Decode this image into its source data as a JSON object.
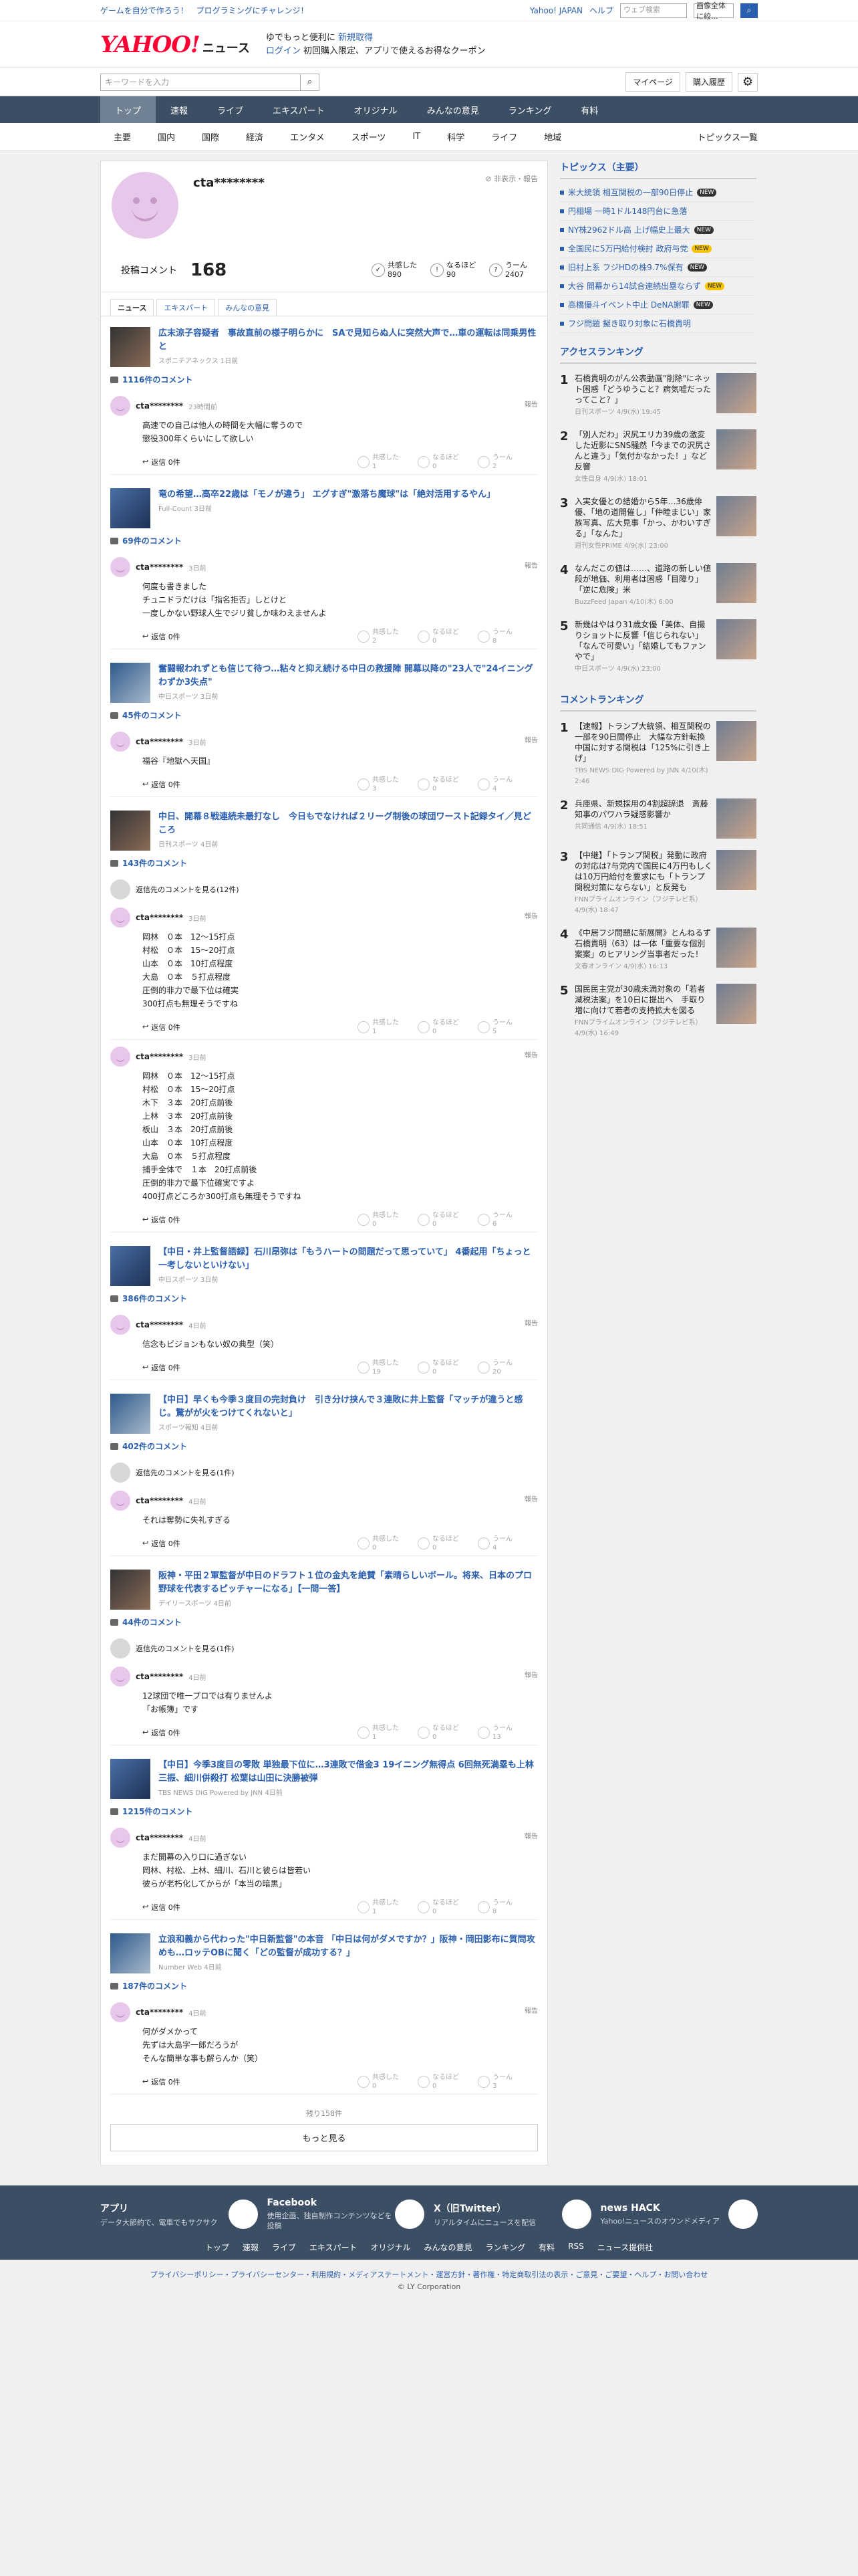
{
  "promo": {
    "left": [
      "ゲームを自分で作ろう！",
      "プログラミングにチャレンジ！"
    ],
    "right": [
      "Yahoo! JAPAN",
      "ヘルプ"
    ],
    "search_placeholder": "ウェブ検索",
    "search_scope": "画像全体に絞..."
  },
  "header": {
    "logo": "YAHOO!",
    "logo_sub": "JAPAN",
    "news": "ニュース",
    "promo1": "ゆでもっと便利に",
    "promo1_blue": "新規取得",
    "promo2_a": "ログイン",
    "promo2_b": "初回購入限定、アプリで使えるお得なクーポン"
  },
  "subheader": {
    "placeholder": "キーワードを入力",
    "mypage": "マイページ",
    "history": "購入履歴"
  },
  "mainnav": [
    "トップ",
    "速報",
    "ライブ",
    "エキスパート",
    "オリジナル",
    "みんなの意見",
    "ランキング",
    "有料"
  ],
  "catnav": [
    "主要",
    "国内",
    "国際",
    "経済",
    "エンタメ",
    "スポーツ",
    "IT",
    "科学",
    "ライフ",
    "地域"
  ],
  "catnav_topics": "トピックス一覧",
  "profile": {
    "name": "cta********",
    "report": "非表示・報告",
    "comment_label": "投稿コメント",
    "comment_count": "168",
    "r1_label": "共感した",
    "r1": "890",
    "r2_label": "なるほど",
    "r2": "90",
    "r3_label": "うーん",
    "r3": "2407"
  },
  "tabs": [
    "ニュース",
    "エキスパート",
    "みんなの意見"
  ],
  "reply_label": "返信 0件",
  "report_label": "報告",
  "vote_labels": [
    "共感した",
    "なるほど",
    "うーん"
  ],
  "articles": [
    {
      "title": "広末涼子容疑者　事故直前の様子明らかに　SAで見知らぬ人に突然大声で…車の運転は同乗男性と",
      "src": "スポニチアネックス 1日前",
      "count": "1116件のコメント",
      "comments": [
        {
          "name": "cta********",
          "time": "23時間前",
          "body": "高速での自己は他人の時間を大幅に奪うので\n懲役300年くらいにして欲しい",
          "votes": [
            "1",
            "0",
            "2"
          ]
        }
      ]
    },
    {
      "title": "竜の希望…高卒22歳は「モノが違う」 エグすぎ\"激落ち魔球\"は「絶対活用するやん」",
      "src": "Full-Count 3日前",
      "count": "69件のコメント",
      "comments": [
        {
          "name": "cta********",
          "time": "3日前",
          "body": "何度も書きました\nチュニドラだけは「指名拒否」しとけと\n一度しかない野球人生でジリ貧しか味わえませんよ",
          "votes": [
            "2",
            "0",
            "8"
          ]
        }
      ]
    },
    {
      "title": "奮闘報われずとも信じて待つ…粘々と抑え続ける中日の救援陣 開幕以降の\"23人で\"24イニングわずか3失点\"",
      "src": "中日スポーツ 3日前",
      "count": "45件のコメント",
      "comments": [
        {
          "name": "cta********",
          "time": "3日前",
          "body": "福谷『地獄へ天国』",
          "votes": [
            "3",
            "0",
            "4"
          ]
        }
      ]
    },
    {
      "title": "中日、開幕８戦連続未最打なし　今日もでなければ２リーグ制後の球団ワースト記録タイ／見どころ",
      "src": "日刊スポーツ 4日前",
      "count": "143件のコメント",
      "prev": "返信先のコメントを見る(12件)",
      "comments": [
        {
          "name": "cta********",
          "time": "3日前",
          "body": "岡林　０本　12〜15打点\n村松　０本　15〜20打点\n山本　０本　10打点程度\n大島　０本　５打点程度\n圧倒的非力で最下位は確実\n300打点も無理そうですね",
          "votes": [
            "1",
            "0",
            "5"
          ]
        },
        {
          "name": "cta********",
          "time": "3日前",
          "body": "岡林　０本　12〜15打点\n村松　０本　15〜20打点\n木下　３本　20打点前後\n上林　３本　20打点前後\n板山　３本　20打点前後\n山本　０本　10打点程度\n大島　０本　５打点程度\n捕手全体で　１本　20打点前後\n圧倒的非力で最下位確実ですよ\n400打点どころか300打点も無理そうですね",
          "votes": [
            "0",
            "0",
            "6"
          ]
        }
      ]
    },
    {
      "title": "【中日・井上監督語録】石川昂弥は「もうハートの問題だって思っていて」 4番起用「ちょっと一考しないといけない」",
      "src": "中日スポーツ 3日前",
      "count": "386件のコメント",
      "comments": [
        {
          "name": "cta********",
          "time": "4日前",
          "body": "信念もビジョンもない奴の典型（笑）",
          "votes": [
            "19",
            "0",
            "20"
          ]
        }
      ]
    },
    {
      "title": "【中日】早くも今季３度目の完封負け　引き分け挟んで３連敗に井上監督「マッチが違うと感じ。驚がが火をつけてくれないと」",
      "src": "スポーツ報知 4日前",
      "count": "402件のコメント",
      "prev": "返信先のコメントを見る(1件)",
      "comments": [
        {
          "name": "cta********",
          "time": "4日前",
          "body": "それは奪勢に失礼すぎる",
          "votes": [
            "0",
            "0",
            "4"
          ]
        }
      ]
    },
    {
      "title": "阪神・平田２軍監督が中日のドラフト１位の金丸を絶賛「素晴らしいボール。将来、日本のプロ野球を代表するピッチャーになる」【一問一答】",
      "src": "デイリースポーツ 4日前",
      "count": "44件のコメント",
      "prev": "返信先のコメントを見る(1件)",
      "comments": [
        {
          "name": "cta********",
          "time": "4日前",
          "body": "12球団で唯一プロでは有りませんよ\n「お帳簿」です",
          "votes": [
            "1",
            "0",
            "13"
          ]
        }
      ]
    },
    {
      "title": "【中日】今季3度目の零敗 単独最下位に…3連敗で借金3 19イニング無得点 6回無死満塁も上林三振、細川併殺打 松葉は山田に決勝被弾",
      "src": "TBS NEWS DIG Powered by JNN 4日前",
      "count": "1215件のコメント",
      "comments": [
        {
          "name": "cta********",
          "time": "4日前",
          "body": "まだ開幕の入り口に過ぎない\n岡林、村松、上林、細川、石川と彼らは皆若い\n彼らが老朽化してからが「本当の暗黒」",
          "votes": [
            "1",
            "0",
            "8"
          ]
        }
      ]
    },
    {
      "title": "立浪和義から代わった\"中日新監督\"の本音 「中日は何がダメですか？」阪神・岡田影布に質問攻めも…ロッテOBに聞く「どの監督が成功する？」",
      "src": "Number Web 4日前",
      "count": "187件のコメント",
      "comments": [
        {
          "name": "cta********",
          "time": "4日前",
          "body": "何がダメかって\n先ずは大島字一郎だろうが\nそんな簡単な事も解らんか（笑）",
          "votes": [
            "0",
            "0",
            "3"
          ]
        }
      ]
    }
  ],
  "more": {
    "count": "残り158件",
    "label": "もっと見る"
  },
  "side": {
    "topics_title": "トピックス（主要）",
    "topics": [
      {
        "t": "米大統領 相互関税の一部90日停止",
        "b": "NEW"
      },
      {
        "t": "円相場 一時1ドル148円台に急落",
        "b": ""
      },
      {
        "t": "NY株2962ドル高 上げ幅史上最大",
        "b": "NEW"
      },
      {
        "t": "全国民に5万円給付検討 政府与党",
        "b": "NEW"
      },
      {
        "t": "旧村上系 フジHDの株9.7%保有",
        "b": "NEW"
      },
      {
        "t": "大谷 開幕から14試合連続出塁ならず",
        "b": "NEW"
      },
      {
        "t": "高橋優斗イベント中止 DeNA謝罪",
        "b": "NEW"
      },
      {
        "t": "フジ問題 擬き取り対象に石橋貴明",
        "b": ""
      }
    ],
    "access_title": "アクセスランキング",
    "access": [
      {
        "n": "1",
        "t": "石橋貴明のがん公表動画\"削除\"にネット困惑「どうゆうこと？病気嘘だったってこと？」",
        "s": "日刊スポーツ 4/9(水) 19:45"
      },
      {
        "n": "2",
        "t": "「別人だわ」沢尻エリカ39歳の激変した近影にSNS騒然「今までの沢尻さんと違う」「気付かなかった！」など反響",
        "s": "女性自身 4/9(水) 18:01"
      },
      {
        "n": "3",
        "t": "入実女優との結婚から5年…36歳俳優、「地の道開催し」「仲睦まじい」家族写真、広大見事「かっ、かわいすぎる」「なんた」",
        "s": "週刊女性PRIME 4/9(水) 23:00"
      },
      {
        "n": "4",
        "t": "なんだこの値は……、道路の新しい値段が地価、利用者は困惑「目障り」「逆に危険」米",
        "s": "BuzzFeed Japan 4/10(木) 6:00"
      },
      {
        "n": "5",
        "t": "新幾はやはり31歳女優「美体、自撮りショットに反響「信じられない」「なんで可愛い」「結婚してもファンやで」",
        "s": "中日スポーツ 4/9(水) 23:00"
      }
    ],
    "cranking_title": "コメントランキング",
    "cranking": [
      {
        "n": "1",
        "t": "【速報】トランプ大統領、相互関税の一部を90日間停止　大幅な方針転換　中国に対する関税は「125%に引き上げ」",
        "s": "TBS NEWS DIG Powered by JNN 4/10(木) 2:46"
      },
      {
        "n": "2",
        "t": "兵庫県、新規採用の4割超辞退　斎藤知事のパワハラ疑惑影響か",
        "s": "共同通信 4/9(水) 18:51"
      },
      {
        "n": "3",
        "t": "【中継】「トランプ関税」発動に政府の対応は?与党内で国民に4万円もしくは10万円給付を要求にも「トランプ関税対策にならない」と反発も",
        "s": "FNNプライムオンライン（フジテレビ系） 4/9(水) 18:47"
      },
      {
        "n": "4",
        "t": "《中居フジ問題に新展開》とんねるず石橋貴明（63）は一体「重要な個別案案」のヒアリング当事者だった！",
        "s": "文春オンライン 4/9(水) 16:13"
      },
      {
        "n": "5",
        "t": "国民民主党が30歳未満対象の「若者減税法案」を10日に提出へ　手取り増に向けて若者の支持拡大を図る",
        "s": "FNNプライムオンライン（フジテレビ系） 4/9(水) 16:49"
      }
    ]
  },
  "footer": {
    "apps": [
      {
        "t": "アプリ",
        "d": "データ大節約で、電車でもサクサク"
      },
      {
        "t": "Facebook",
        "d": "使用企画、独自制作コンテンツなどを投稿"
      },
      {
        "t": "X（旧Twitter）",
        "d": "リアルタイムにニュースを配信"
      },
      {
        "t": "news HACK",
        "d": "Yahoo!ニュースのオウンドメディア"
      }
    ],
    "links": [
      "トップ",
      "速報",
      "ライブ",
      "エキスパート",
      "オリジナル",
      "みんなの意見",
      "ランキング",
      "有料",
      "RSS",
      "ニュース提供社"
    ],
    "legal": "プライバシーポリシー・プライバシーセンター・利用規約・メディアステートメント・運営方針・著作権・特定商取引法の表示・ご意見・ご要望・ヘルプ・お問い合わせ",
    "copy": "© LY Corporation"
  }
}
